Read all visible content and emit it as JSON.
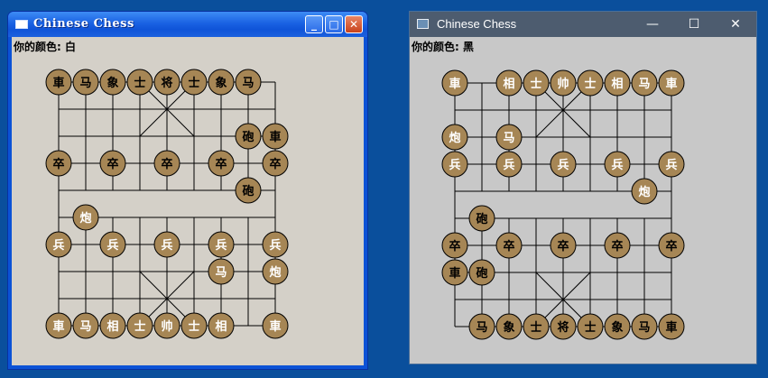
{
  "windows": [
    {
      "title": "Chinese Chess",
      "color_label": "你的颜色: 白",
      "pieces": [
        {
          "c": 0,
          "r": 0,
          "t": "車",
          "k": "dark"
        },
        {
          "c": 1,
          "r": 0,
          "t": "马",
          "k": "dark"
        },
        {
          "c": 2,
          "r": 0,
          "t": "象",
          "k": "dark"
        },
        {
          "c": 3,
          "r": 0,
          "t": "士",
          "k": "dark"
        },
        {
          "c": 4,
          "r": 0,
          "t": "将",
          "k": "dark"
        },
        {
          "c": 5,
          "r": 0,
          "t": "士",
          "k": "dark"
        },
        {
          "c": 6,
          "r": 0,
          "t": "象",
          "k": "dark"
        },
        {
          "c": 7,
          "r": 0,
          "t": "马",
          "k": "dark"
        },
        {
          "c": 7,
          "r": 2,
          "t": "砲",
          "k": "dark"
        },
        {
          "c": 8,
          "r": 2,
          "t": "車",
          "k": "dark"
        },
        {
          "c": 0,
          "r": 3,
          "t": "卒",
          "k": "dark"
        },
        {
          "c": 2,
          "r": 3,
          "t": "卒",
          "k": "dark"
        },
        {
          "c": 4,
          "r": 3,
          "t": "卒",
          "k": "dark"
        },
        {
          "c": 6,
          "r": 3,
          "t": "卒",
          "k": "dark"
        },
        {
          "c": 8,
          "r": 3,
          "t": "卒",
          "k": "dark"
        },
        {
          "c": 7,
          "r": 4,
          "t": "砲",
          "k": "dark"
        },
        {
          "c": 1,
          "r": 5,
          "t": "炮",
          "k": "light"
        },
        {
          "c": 0,
          "r": 6,
          "t": "兵",
          "k": "light"
        },
        {
          "c": 2,
          "r": 6,
          "t": "兵",
          "k": "light"
        },
        {
          "c": 4,
          "r": 6,
          "t": "兵",
          "k": "light"
        },
        {
          "c": 6,
          "r": 6,
          "t": "兵",
          "k": "light"
        },
        {
          "c": 8,
          "r": 6,
          "t": "兵",
          "k": "light"
        },
        {
          "c": 6,
          "r": 7,
          "t": "马",
          "k": "light"
        },
        {
          "c": 8,
          "r": 7,
          "t": "炮",
          "k": "light"
        },
        {
          "c": 0,
          "r": 9,
          "t": "車",
          "k": "light"
        },
        {
          "c": 1,
          "r": 9,
          "t": "马",
          "k": "light"
        },
        {
          "c": 2,
          "r": 9,
          "t": "相",
          "k": "light"
        },
        {
          "c": 3,
          "r": 9,
          "t": "士",
          "k": "light"
        },
        {
          "c": 4,
          "r": 9,
          "t": "帅",
          "k": "light"
        },
        {
          "c": 5,
          "r": 9,
          "t": "士",
          "k": "light"
        },
        {
          "c": 6,
          "r": 9,
          "t": "相",
          "k": "light"
        },
        {
          "c": 8,
          "r": 9,
          "t": "車",
          "k": "light"
        }
      ]
    },
    {
      "title": "Chinese Chess",
      "color_label": "你的颜色: 黑",
      "pieces": [
        {
          "c": 0,
          "r": 0,
          "t": "車",
          "k": "light"
        },
        {
          "c": 2,
          "r": 0,
          "t": "相",
          "k": "light"
        },
        {
          "c": 3,
          "r": 0,
          "t": "士",
          "k": "light"
        },
        {
          "c": 4,
          "r": 0,
          "t": "帅",
          "k": "light"
        },
        {
          "c": 5,
          "r": 0,
          "t": "士",
          "k": "light"
        },
        {
          "c": 6,
          "r": 0,
          "t": "相",
          "k": "light"
        },
        {
          "c": 7,
          "r": 0,
          "t": "马",
          "k": "light"
        },
        {
          "c": 8,
          "r": 0,
          "t": "車",
          "k": "light"
        },
        {
          "c": 0,
          "r": 2,
          "t": "炮",
          "k": "light"
        },
        {
          "c": 2,
          "r": 2,
          "t": "马",
          "k": "light"
        },
        {
          "c": 0,
          "r": 3,
          "t": "兵",
          "k": "light"
        },
        {
          "c": 2,
          "r": 3,
          "t": "兵",
          "k": "light"
        },
        {
          "c": 4,
          "r": 3,
          "t": "兵",
          "k": "light"
        },
        {
          "c": 6,
          "r": 3,
          "t": "兵",
          "k": "light"
        },
        {
          "c": 8,
          "r": 3,
          "t": "兵",
          "k": "light"
        },
        {
          "c": 7,
          "r": 4,
          "t": "炮",
          "k": "light"
        },
        {
          "c": 1,
          "r": 5,
          "t": "砲",
          "k": "dark"
        },
        {
          "c": 0,
          "r": 6,
          "t": "卒",
          "k": "dark"
        },
        {
          "c": 2,
          "r": 6,
          "t": "卒",
          "k": "dark"
        },
        {
          "c": 4,
          "r": 6,
          "t": "卒",
          "k": "dark"
        },
        {
          "c": 6,
          "r": 6,
          "t": "卒",
          "k": "dark"
        },
        {
          "c": 8,
          "r": 6,
          "t": "卒",
          "k": "dark"
        },
        {
          "c": 0,
          "r": 7,
          "t": "車",
          "k": "dark"
        },
        {
          "c": 1,
          "r": 7,
          "t": "砲",
          "k": "dark"
        },
        {
          "c": 1,
          "r": 9,
          "t": "马",
          "k": "dark"
        },
        {
          "c": 2,
          "r": 9,
          "t": "象",
          "k": "dark"
        },
        {
          "c": 3,
          "r": 9,
          "t": "士",
          "k": "dark"
        },
        {
          "c": 4,
          "r": 9,
          "t": "将",
          "k": "dark"
        },
        {
          "c": 5,
          "r": 9,
          "t": "士",
          "k": "dark"
        },
        {
          "c": 6,
          "r": 9,
          "t": "象",
          "k": "dark"
        },
        {
          "c": 7,
          "r": 9,
          "t": "马",
          "k": "dark"
        },
        {
          "c": 8,
          "r": 9,
          "t": "車",
          "k": "dark"
        }
      ]
    }
  ],
  "buttons": {
    "xp_minimize": "_",
    "xp_maximize": "□",
    "xp_close": "✕",
    "ten_minimize": "—",
    "ten_maximize": "☐",
    "ten_close": "✕"
  },
  "icons": [
    "window-app-icon",
    "minimize-icon",
    "maximize-icon",
    "close-icon"
  ],
  "colors": {
    "desktop": "#0a4f9c",
    "piece": "#a68655",
    "text_dark": "#000000",
    "text_light": "#ffffff",
    "xp_client": "#d4d0c8",
    "ten_client": "#c8c8c8",
    "ten_titlebar": "#4d5c6f"
  }
}
